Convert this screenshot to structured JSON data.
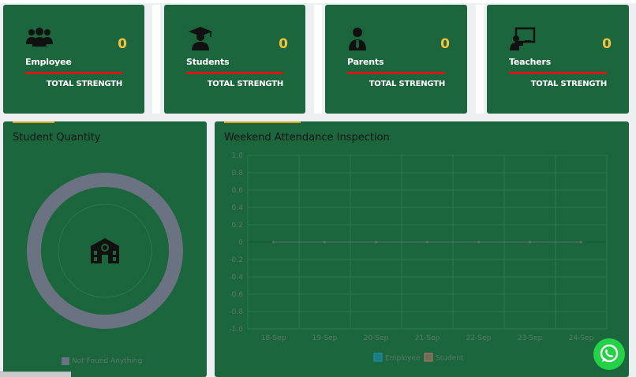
{
  "stats": [
    {
      "label": "Employee",
      "value": "0",
      "sub": "TOTAL STRENGTH",
      "icon": "users-icon"
    },
    {
      "label": "Students",
      "value": "0",
      "sub": "TOTAL STRENGTH",
      "icon": "graduate-icon"
    },
    {
      "label": "Parents",
      "value": "0",
      "sub": "TOTAL STRENGTH",
      "icon": "person-tie-icon"
    },
    {
      "label": "Teachers",
      "value": "0",
      "sub": "TOTAL STRENGTH",
      "icon": "teacher-board-icon"
    }
  ],
  "student_panel": {
    "title": "Student Quantity",
    "legend": "Not Found Anything",
    "legend_color": "#6b7383",
    "center_icon": "school-icon"
  },
  "attendance_panel": {
    "title": "Weekend Attendance Inspection"
  },
  "colors": {
    "card_bg": "#1c663d",
    "value": "#f4c23c",
    "bar": "#d01818",
    "accent": "#d8a520",
    "whatsapp": "#24d247"
  },
  "chart_data": {
    "type": "line",
    "title": "Weekend Attendance Inspection",
    "x": [
      "18-Sep",
      "19-Sep",
      "20-Sep",
      "21-Sep",
      "22-Sep",
      "23-Sep",
      "24-Sep"
    ],
    "series": [
      {
        "name": "Employee",
        "values": [
          0,
          0,
          0,
          0,
          0,
          0,
          0
        ],
        "color": "#1e90b4"
      },
      {
        "name": "Student",
        "values": [
          0,
          0,
          0,
          0,
          0,
          0,
          0
        ],
        "color": "#b4756a"
      }
    ],
    "ylim": [
      -1.0,
      1.0
    ],
    "yticks": [
      "1.0",
      "0.8",
      "0.6",
      "0.4",
      "0.2",
      "0",
      "-0.2",
      "-0.4",
      "-0.6",
      "-0.8",
      "-1.0"
    ],
    "grid": true,
    "legend": "bottom"
  },
  "whatsapp": {
    "icon": "whatsapp-icon"
  }
}
